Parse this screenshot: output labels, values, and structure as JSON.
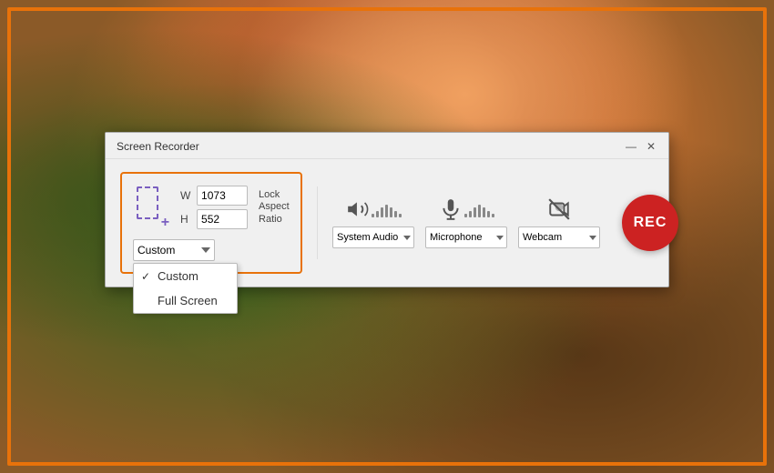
{
  "app": {
    "title": "Screen Recorder",
    "border_color": "#e8720a"
  },
  "titlebar": {
    "title": "Screen Recorder",
    "minimize_label": "—",
    "close_label": "✕"
  },
  "record_area": {
    "w_label": "W",
    "h_label": "H",
    "w_value": "1073",
    "h_value": "552",
    "mode_selected": "Custom",
    "mode_options": [
      "Custom",
      "Full Screen"
    ],
    "lock_aspect_label": "Lock Aspect\nRatio"
  },
  "dropdown": {
    "custom_label": "Custom",
    "fullscreen_label": "Full Screen"
  },
  "audio_video": {
    "system_audio_label": "System Audio",
    "microphone_label": "Microphone",
    "webcam_label": "Webcam",
    "system_audio_options": [
      "System Audio"
    ],
    "microphone_options": [
      "Microphone"
    ],
    "webcam_options": [
      "Webcam"
    ]
  },
  "rec_button": {
    "label": "REC"
  },
  "vol_bars": {
    "heights": [
      4,
      7,
      10,
      13,
      10,
      7,
      4
    ]
  }
}
